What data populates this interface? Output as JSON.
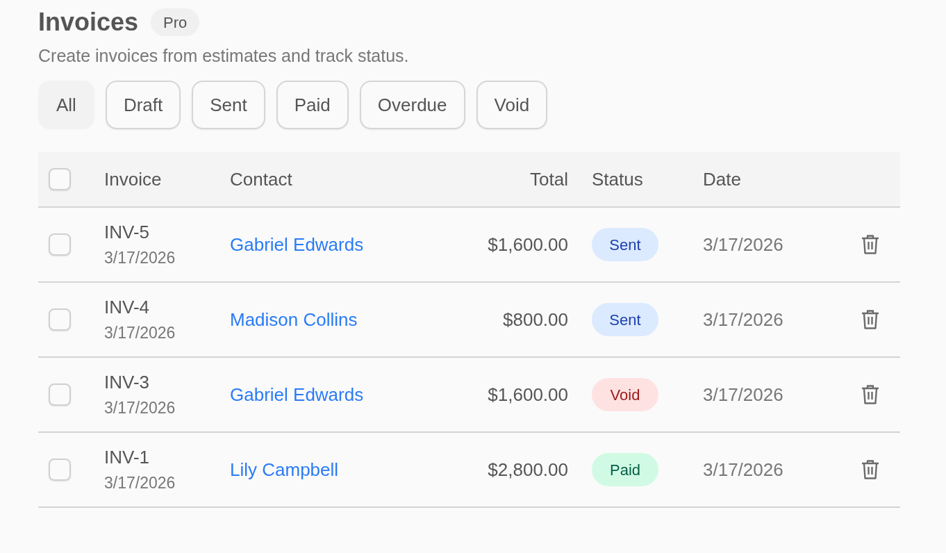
{
  "header": {
    "title": "Invoices",
    "badge": "Pro",
    "subtitle": "Create invoices from estimates and track status."
  },
  "filters": [
    {
      "label": "All",
      "selected": true
    },
    {
      "label": "Draft",
      "selected": false
    },
    {
      "label": "Sent",
      "selected": false
    },
    {
      "label": "Paid",
      "selected": false
    },
    {
      "label": "Overdue",
      "selected": false
    },
    {
      "label": "Void",
      "selected": false
    }
  ],
  "table": {
    "select_all": {
      "checked": false
    },
    "columns": [
      "Invoice",
      "Contact",
      "Total",
      "Status",
      "Date"
    ],
    "rows": [
      {
        "checked": false,
        "invoice": "INV-5",
        "created": "3/17/2026",
        "contact": "Gabriel Edwards",
        "total": "$1,600.00",
        "status": {
          "label": "Sent",
          "kind": "sent"
        },
        "date": "3/17/2026"
      },
      {
        "checked": false,
        "invoice": "INV-4",
        "created": "3/17/2026",
        "contact": "Madison Collins",
        "total": "$800.00",
        "status": {
          "label": "Sent",
          "kind": "sent"
        },
        "date": "3/17/2026"
      },
      {
        "checked": false,
        "invoice": "INV-3",
        "created": "3/17/2026",
        "contact": "Gabriel Edwards",
        "total": "$1,600.00",
        "status": {
          "label": "Void",
          "kind": "void"
        },
        "date": "3/17/2026"
      },
      {
        "checked": false,
        "invoice": "INV-1",
        "created": "3/17/2026",
        "contact": "Lily Campbell",
        "total": "$2,800.00",
        "status": {
          "label": "Paid",
          "kind": "paid"
        },
        "date": "3/17/2026"
      }
    ]
  }
}
